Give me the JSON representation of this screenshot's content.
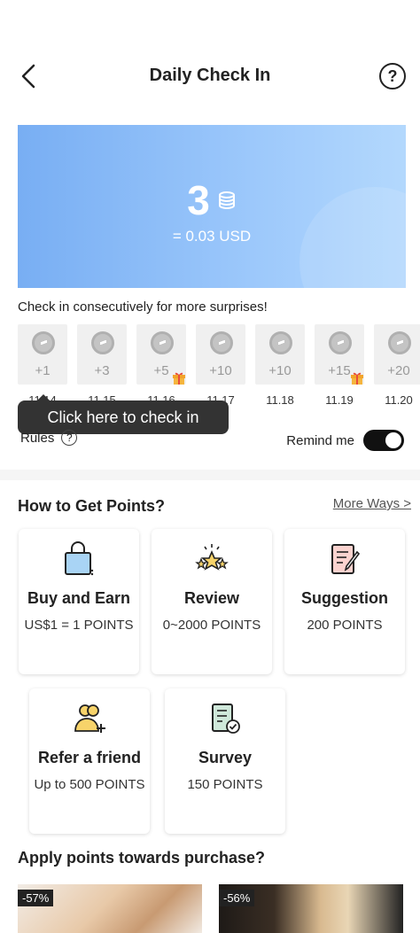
{
  "header": {
    "title": "Daily Check In",
    "help_symbol": "?"
  },
  "banner": {
    "points": "3",
    "usd_text": "= 0.03 USD",
    "bg_color": "#8cbcf7"
  },
  "checkin": {
    "consecutive_text": "Check in consecutively for more surprises!",
    "days": [
      {
        "plus": "+1",
        "date": "11.14",
        "gift": false
      },
      {
        "plus": "+3",
        "date": "11.15",
        "gift": false
      },
      {
        "plus": "+5",
        "date": "11.16",
        "gift": true
      },
      {
        "plus": "+10",
        "date": "11.17",
        "gift": false
      },
      {
        "plus": "+10",
        "date": "11.18",
        "gift": false
      },
      {
        "plus": "+15",
        "date": "11.19",
        "gift": true
      },
      {
        "plus": "+20",
        "date": "11.20",
        "gift": false
      }
    ],
    "tooltip": "Click here to check in",
    "rules_label": "Rules",
    "remind_label": "Remind me",
    "remind_on": true
  },
  "get_points": {
    "title": "How to Get Points?",
    "more_ways": "More Ways >",
    "cards": [
      {
        "icon": "shopping-bag-icon",
        "title": "Buy and Earn",
        "sub": "US$1 = 1 POINTS"
      },
      {
        "icon": "stars-icon",
        "title": "Review",
        "sub": "0~2000 POINTS"
      },
      {
        "icon": "note-pencil-icon",
        "title": "Suggestion",
        "sub": "200 POINTS"
      },
      {
        "icon": "add-friend-icon",
        "title": "Refer a friend",
        "sub": "Up to 500 POINTS"
      },
      {
        "icon": "survey-check-icon",
        "title": "Survey",
        "sub": "150 POINTS"
      }
    ]
  },
  "apply": {
    "title": "Apply points towards purchase?",
    "products": [
      {
        "discount": "-57%"
      },
      {
        "discount": "-56%"
      }
    ]
  }
}
